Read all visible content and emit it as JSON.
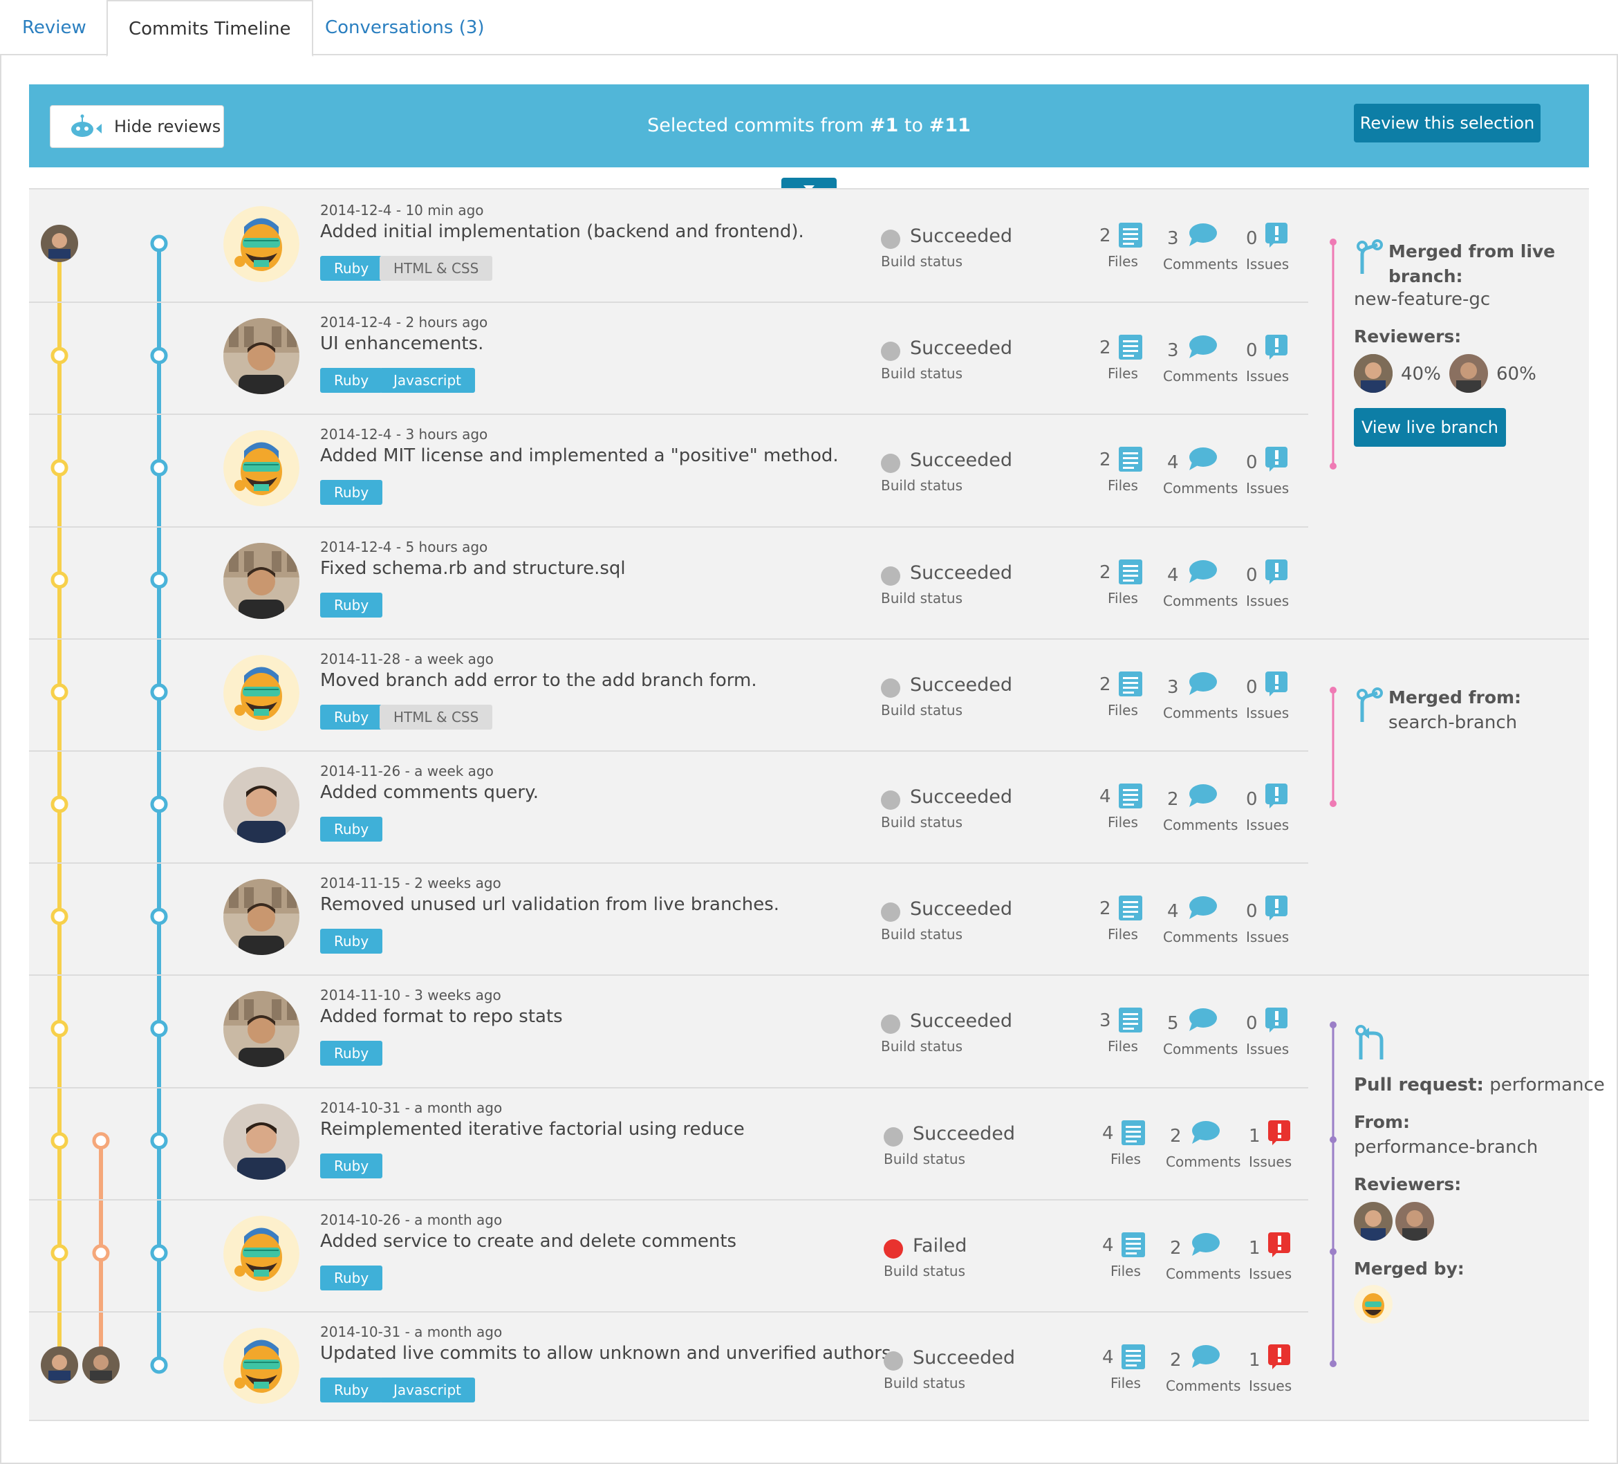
{
  "tabs": [
    {
      "label": "Review"
    },
    {
      "label": "Commits Timeline"
    },
    {
      "label": "Conversations (3)"
    }
  ],
  "banner": {
    "hide_label": "Hide reviews",
    "title_prefix": "Selected commits from ",
    "from": "#1",
    "to_word": " to ",
    "to": "#11",
    "review_label": "Review this selection"
  },
  "labels": {
    "build_status": "Build status",
    "files": "Files",
    "comments": "Comments",
    "issues": "Issues"
  },
  "colors": {
    "accent": "#51b6d8",
    "dark_accent": "#0d7ea6",
    "success": "#b8b8b8",
    "failed": "#e8322e",
    "issue_alert": "#e8322e",
    "branch_yellow": "#f7d04b",
    "branch_blue": "#4ab3d9",
    "branch_orange": "#f5a77a",
    "merge_pink": "#ef7ab4",
    "merge_purple": "#9b7fc7"
  },
  "commits": [
    {
      "date": "2014-12-4 - 10 min ago",
      "message": "Added initial implementation (backend and frontend).",
      "tags": [
        "Ruby",
        "HTML & CSS"
      ],
      "status": "Succeeded",
      "files": "2",
      "comments": "3",
      "issues": "0",
      "avatar": "cartoon"
    },
    {
      "date": "2014-12-4 - 2 hours ago",
      "message": "UI enhancements.",
      "tags": [
        "Ruby",
        "Javascript"
      ],
      "status": "Succeeded",
      "files": "2",
      "comments": "3",
      "issues": "0",
      "avatar": "photo-a"
    },
    {
      "date": "2014-12-4 - 3 hours ago",
      "message": "Added MIT license and implemented a \"positive\" method.",
      "tags": [
        "Ruby"
      ],
      "status": "Succeeded",
      "files": "2",
      "comments": "4",
      "issues": "0",
      "avatar": "cartoon"
    },
    {
      "date": "2014-12-4 - 5 hours ago",
      "message": "Fixed schema.rb and structure.sql",
      "tags": [
        "Ruby"
      ],
      "status": "Succeeded",
      "files": "2",
      "comments": "4",
      "issues": "0",
      "avatar": "photo-a"
    },
    {
      "date": "2014-11-28 - a week ago",
      "message": "Moved branch add error to the add branch form.",
      "tags": [
        "Ruby",
        "HTML & CSS"
      ],
      "status": "Succeeded",
      "files": "2",
      "comments": "3",
      "issues": "0",
      "avatar": "cartoon"
    },
    {
      "date": "2014-11-26 - a week ago",
      "message": "Added comments query.",
      "tags": [
        "Ruby"
      ],
      "status": "Succeeded",
      "files": "4",
      "comments": "2",
      "issues": "0",
      "avatar": "photo-b"
    },
    {
      "date": "2014-11-15 - 2 weeks ago",
      "message": "Removed unused url validation from live branches.",
      "tags": [
        "Ruby"
      ],
      "status": "Succeeded",
      "files": "2",
      "comments": "4",
      "issues": "0",
      "avatar": "photo-a"
    },
    {
      "date": "2014-11-10 - 3 weeks ago",
      "message": "Added format to repo stats",
      "tags": [
        "Ruby"
      ],
      "status": "Succeeded",
      "files": "3",
      "comments": "5",
      "issues": "0",
      "avatar": "photo-a"
    },
    {
      "date": "2014-10-31 - a month ago",
      "message": "Reimplemented iterative factorial using reduce",
      "tags": [
        "Ruby"
      ],
      "status": "Succeeded",
      "files": "4",
      "comments": "2",
      "issues": "1",
      "avatar": "photo-b"
    },
    {
      "date": "2014-10-26 - a month ago",
      "message": "Added service to create and delete comments",
      "tags": [
        "Ruby"
      ],
      "status": "Failed",
      "files": "4",
      "comments": "2",
      "issues": "1",
      "avatar": "cartoon"
    },
    {
      "date": "2014-10-31 - a month ago",
      "message": "Updated live commits to allow unknown and unverified authors.",
      "tags": [
        "Ruby",
        "Javascript"
      ],
      "status": "Succeeded",
      "files": "4",
      "comments": "2",
      "issues": "1",
      "avatar": "cartoon"
    }
  ],
  "side": {
    "merge1": {
      "title": "Merged from live branch:",
      "branch": "new-feature-gc",
      "reviewers_label": "Reviewers:",
      "reviewer1_pct": "40%",
      "reviewer2_pct": "60%",
      "button": "View live branch"
    },
    "merge2": {
      "title": "Merged from:",
      "branch": "search-branch"
    },
    "pr": {
      "label": "Pull request:",
      "name": "performance",
      "from_label": "From:",
      "from_branch": "performance-branch",
      "reviewers_label": "Reviewers:",
      "merged_by_label": "Merged by:"
    }
  }
}
